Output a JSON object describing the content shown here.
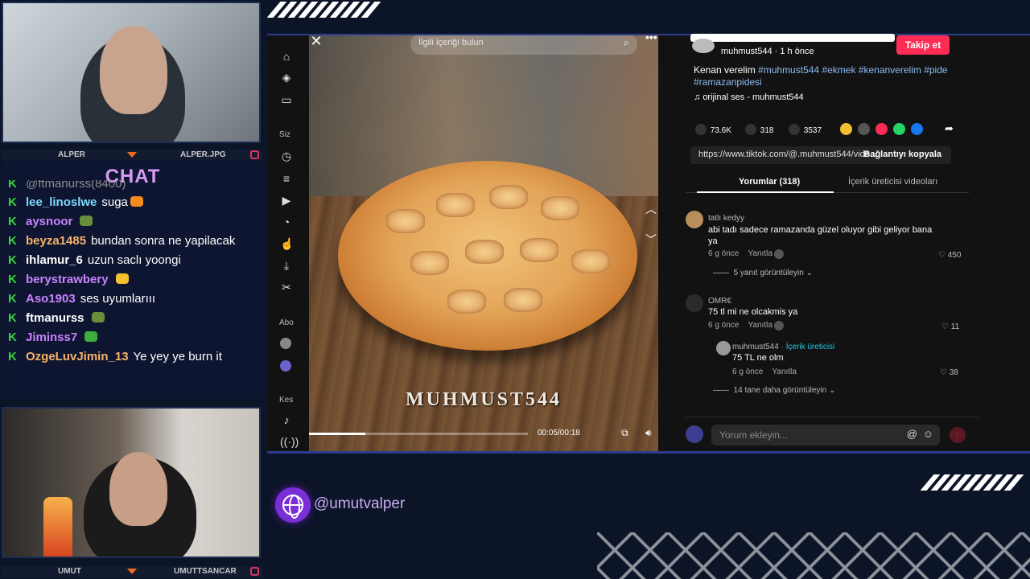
{
  "webcam_top": {
    "name_left": "ALPER",
    "name_right": "ALPER.JPG"
  },
  "webcam_bottom": {
    "name_left": "UMUT",
    "name_right": "UMUTTSANCAR"
  },
  "chat": {
    "title": "CHAT",
    "cut_line": "@ftmanurss(8400)",
    "messages": [
      {
        "user": "lee_linoslwe",
        "user_color": "#7fd9ff",
        "text": "suga",
        "emote": "fire",
        "emote_color": "#f58a1f"
      },
      {
        "user": "aysnoor",
        "user_color": "#c983ff",
        "text": "",
        "emote": "tank",
        "emote_color": "#6a8f3a"
      },
      {
        "user": "beyza1485",
        "user_color": "#f7b36b",
        "text": "bundan sonra ne yapilacak",
        "emote": "",
        "emote_color": ""
      },
      {
        "user": "ihlamur_6",
        "user_color": "#ffffff",
        "text": "uzun saclı yoongi",
        "emote": "",
        "emote_color": ""
      },
      {
        "user": "berystrawbery",
        "user_color": "#c983ff",
        "text": "",
        "emote": "crown",
        "emote_color": "#f3c22a"
      },
      {
        "user": "Aso1903",
        "user_color": "#c983ff",
        "text": "ses uyumlarııı",
        "emote": "",
        "emote_color": ""
      },
      {
        "user": "ftmanurss",
        "user_color": "#ffffff",
        "text": "",
        "emote": "tank",
        "emote_color": "#6a8f3a"
      },
      {
        "user": "Jiminss7",
        "user_color": "#c983ff",
        "text": "",
        "emote": "pepe",
        "emote_color": "#3fae3d"
      },
      {
        "user": "OzgeLuvJimin_13",
        "user_color": "#f7b36b",
        "text": "Ye yey ye burn it",
        "emote": "",
        "emote_color": ""
      }
    ]
  },
  "sidebar": {
    "section_siz": "Siz",
    "section_abo": "Abo",
    "section_kes": "Kes"
  },
  "video": {
    "search_placeholder": "İlgili içeriği bulun",
    "watermark": "MUHMUST544",
    "time": "00:05/00:18",
    "progress_fraction": 0.28
  },
  "post": {
    "follow_label": "Takip et",
    "author_line": "muhmust544 · 1 h önce",
    "caption_text": "Kenan verelim ",
    "hashtags": [
      "#muhmust544",
      "#ekmek",
      "#kenanverelim",
      "#pide",
      "#ramazanpidesi"
    ],
    "sound": "orijinal ses - muhmust544",
    "likes": "73.6K",
    "comments": "318",
    "saves": "3537",
    "link": "https://www.tiktok.com/@.muhmust544/vide...",
    "copy_link_label": "Bağlantıyı kopyala",
    "share_colors": [
      "#f2c02c",
      "#555555",
      "#fe2c55",
      "#25d366",
      "#1877f2"
    ]
  },
  "tabs": {
    "comments": "Yorumlar (318)",
    "creator_videos": "İçerik üreticisi videoları"
  },
  "comments": [
    {
      "user": "tatlı kedyy",
      "text": "abi tadı sadece ramazanda güzel oluyor gibi geliyor bana ya",
      "ago": "6 g önce",
      "reply": "Yanıtla",
      "likes": "450",
      "more": "5 yanıt görüntüleyin"
    },
    {
      "user": "OMR€",
      "text": "75 tl mi ne olcakmis ya",
      "ago": "6 g önce",
      "reply": "Yanıtla",
      "likes": "11"
    }
  ],
  "reply": {
    "user": "muhmust544",
    "creator_badge": "· İçerik üreticisi",
    "text": "75 TL ne olm",
    "ago": "6 g önce",
    "reply": "Yanıtla",
    "likes": "38",
    "more": "14 tane daha görüntüleyin"
  },
  "add_comment": {
    "placeholder": "Yorum ekleyin..."
  },
  "footer": {
    "handle": "@umutvalper"
  }
}
